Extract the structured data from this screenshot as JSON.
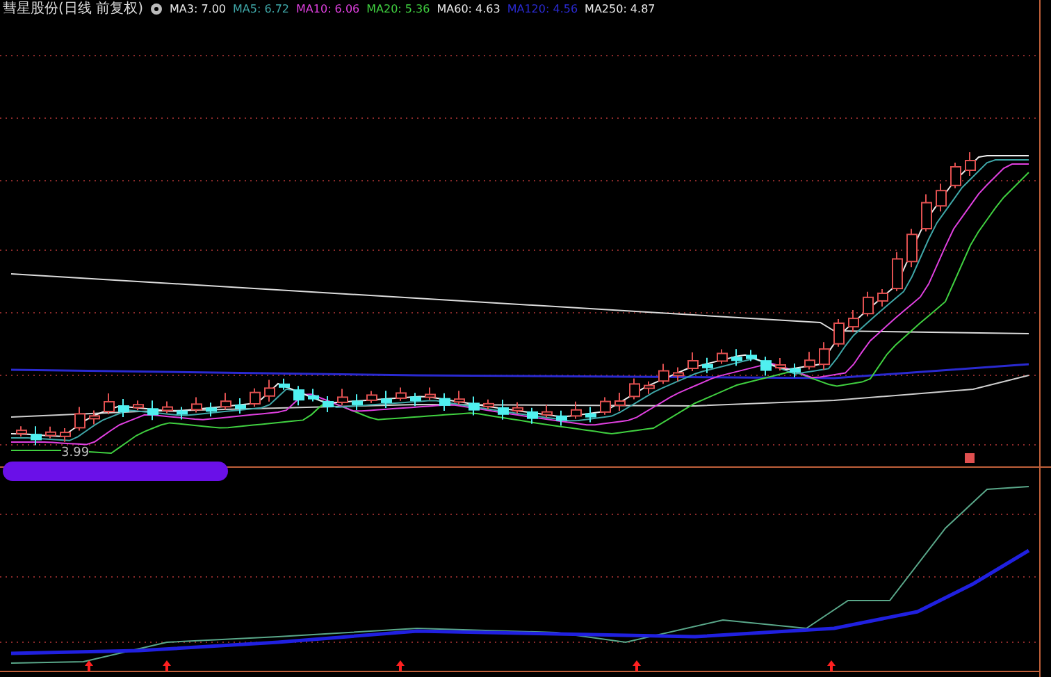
{
  "chart_title": "彗星股份(日线 前复权)",
  "legend": [
    {
      "label": "MA3: 7.00",
      "color": "#e8e8e8"
    },
    {
      "label": "MA5: 6.72",
      "color": "#3fa7a8"
    },
    {
      "label": "MA10: 6.06",
      "color": "#e040e0"
    },
    {
      "label": "MA20: 5.36",
      "color": "#40d040"
    },
    {
      "label": "MA60: 4.63",
      "color": "#e8e8e8"
    },
    {
      "label": "MA120: 4.56",
      "color": "#2a2ad0"
    },
    {
      "label": "MA250: 4.87",
      "color": "#e8e8e8"
    }
  ],
  "low_label": "3.99"
}
